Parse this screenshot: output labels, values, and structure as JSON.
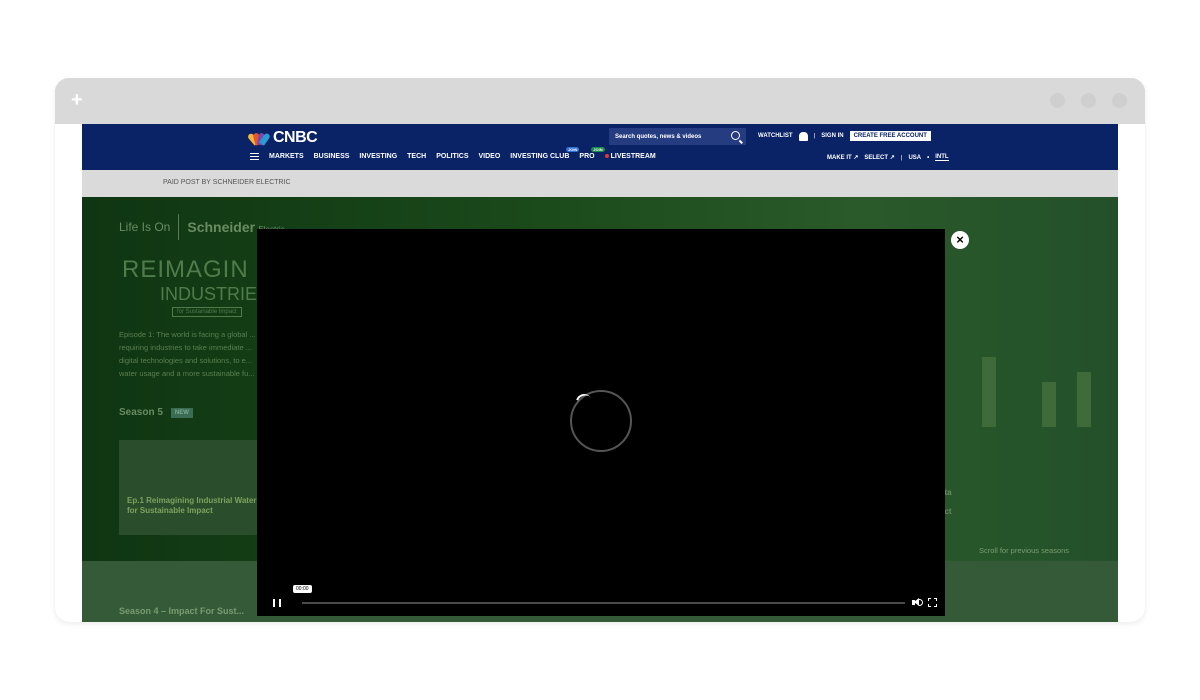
{
  "browser": {
    "new_tab_label": "+"
  },
  "header": {
    "logo_text": "CNBC",
    "search_placeholder": "Search quotes, news & videos",
    "watchlist": "WATCHLIST",
    "sign_in": "SIGN IN",
    "create_account": "CREATE FREE ACCOUNT",
    "separator": "|",
    "nav": [
      {
        "label": "MARKETS"
      },
      {
        "label": "BUSINESS"
      },
      {
        "label": "INVESTING"
      },
      {
        "label": "TECH"
      },
      {
        "label": "POLITICS"
      },
      {
        "label": "VIDEO"
      },
      {
        "label": "INVESTING CLUB",
        "badge": "JOIN"
      },
      {
        "label": "PRO",
        "badge": "JOIN"
      },
      {
        "label": "LIVESTREAM"
      }
    ],
    "nav_right": {
      "make_it": "MAKE IT",
      "select": "SELECT",
      "usa": "USA",
      "dash": "•",
      "intl": "INTL",
      "arrow": "↗"
    }
  },
  "paid_post": "PAID POST BY SCHNEIDER ELECTRIC",
  "hero": {
    "life_is_on": "Life Is On",
    "brand": "Schneider",
    "brand_sub": "Electric",
    "title_line1": "REIMAGIN",
    "title_line2": "INDUSTRIE",
    "title_tag": "for Sustainable Impact",
    "description": "Episode 1: The world is facing a global ... requiring industries to take immediate ... digital technologies and solutions, to e... water usage and a more sustainable fu...",
    "season5": "Season 5",
    "new_badge": "NEW",
    "episode_title": "Ep.1 Reimagining Industrial Water for Sustainable Impact",
    "right_text1": "ata",
    "right_text2": "act",
    "scroll_prev": "Scroll for previous seasons",
    "season4": "Season 4 – Impact For Sust..."
  },
  "video": {
    "timestamp": "00:00",
    "progress": 0,
    "close_label": "×"
  },
  "colors": {
    "cnbc_navy": "#0a2266",
    "overlay_green": "#1c3a18",
    "video_bg": "#000000"
  }
}
